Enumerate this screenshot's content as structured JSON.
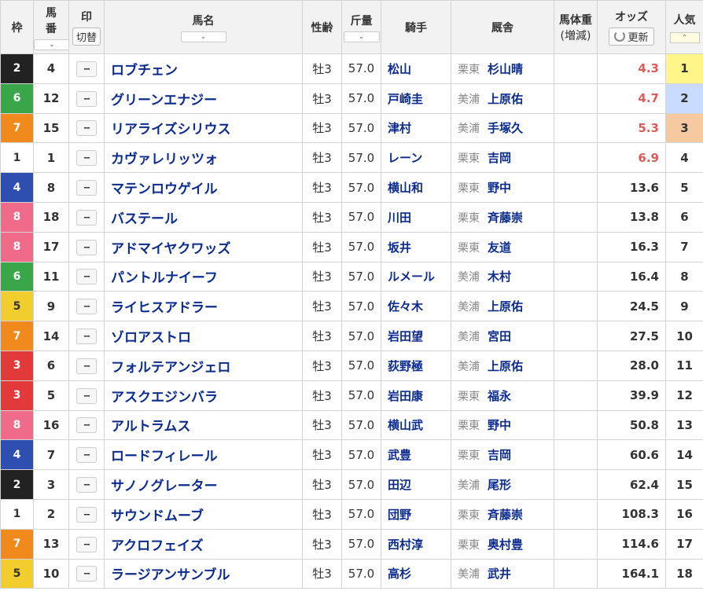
{
  "header": {
    "waku": "枠",
    "umaban_1": "馬",
    "umaban_2": "番",
    "mark": "印",
    "mark_toggle": "切替",
    "name": "馬名",
    "sexage": "性齢",
    "weight": "斤量",
    "jockey": "騎手",
    "stable": "厩舎",
    "bodyweight_1": "馬体重",
    "bodyweight_2": "(増減)",
    "odds": "オッズ",
    "refresh": "更新",
    "popularity": "人気",
    "sort_glyph": "⌄",
    "sort_up_glyph": "⌃"
  },
  "waku_colors": {
    "1": {
      "bg": "#ffffff",
      "fg": "#333333"
    },
    "2": {
      "bg": "#222222",
      "fg": "#ffffff"
    },
    "3": {
      "bg": "#e23a3a",
      "fg": "#ffffff"
    },
    "4": {
      "bg": "#2f4fb0",
      "fg": "#ffffff"
    },
    "5": {
      "bg": "#f2cd2e",
      "fg": "#333333"
    },
    "6": {
      "bg": "#3aa64a",
      "fg": "#ffffff"
    },
    "7": {
      "bg": "#f08a1c",
      "fg": "#ffffff"
    },
    "8": {
      "bg": "#f06a8a",
      "fg": "#ffffff"
    }
  },
  "mark_placeholder": "--",
  "rows": [
    {
      "waku": "2",
      "umaban": "4",
      "name": "ロブチェン",
      "sexage": "牡3",
      "weight": "57.0",
      "jockey": "松山",
      "region": "栗東",
      "trainer": "杉山晴",
      "odds": "4.3",
      "pop": "1"
    },
    {
      "waku": "6",
      "umaban": "12",
      "name": "グリーンエナジー",
      "sexage": "牡3",
      "weight": "57.0",
      "jockey": "戸崎圭",
      "region": "美浦",
      "trainer": "上原佑",
      "odds": "4.7",
      "pop": "2"
    },
    {
      "waku": "7",
      "umaban": "15",
      "name": "リアライズシリウス",
      "sexage": "牡3",
      "weight": "57.0",
      "jockey": "津村",
      "region": "美浦",
      "trainer": "手塚久",
      "odds": "5.3",
      "pop": "3"
    },
    {
      "waku": "1",
      "umaban": "1",
      "name": "カヴァレリッツォ",
      "sexage": "牡3",
      "weight": "57.0",
      "jockey": "レーン",
      "region": "栗東",
      "trainer": "吉岡",
      "odds": "6.9",
      "pop": "4"
    },
    {
      "waku": "4",
      "umaban": "8",
      "name": "マテンロウゲイル",
      "sexage": "牡3",
      "weight": "57.0",
      "jockey": "横山和",
      "region": "栗東",
      "trainer": "野中",
      "odds": "13.6",
      "pop": "5"
    },
    {
      "waku": "8",
      "umaban": "18",
      "name": "バステール",
      "sexage": "牡3",
      "weight": "57.0",
      "jockey": "川田",
      "region": "栗東",
      "trainer": "斉藤崇",
      "odds": "13.8",
      "pop": "6"
    },
    {
      "waku": "8",
      "umaban": "17",
      "name": "アドマイヤクワッズ",
      "sexage": "牡3",
      "weight": "57.0",
      "jockey": "坂井",
      "region": "栗東",
      "trainer": "友道",
      "odds": "16.3",
      "pop": "7"
    },
    {
      "waku": "6",
      "umaban": "11",
      "name": "パントルナイーフ",
      "sexage": "牡3",
      "weight": "57.0",
      "jockey": "ルメール",
      "region": "美浦",
      "trainer": "木村",
      "odds": "16.4",
      "pop": "8"
    },
    {
      "waku": "5",
      "umaban": "9",
      "name": "ライヒスアドラー",
      "sexage": "牡3",
      "weight": "57.0",
      "jockey": "佐々木",
      "region": "美浦",
      "trainer": "上原佑",
      "odds": "24.5",
      "pop": "9"
    },
    {
      "waku": "7",
      "umaban": "14",
      "name": "ゾロアストロ",
      "sexage": "牡3",
      "weight": "57.0",
      "jockey": "岩田望",
      "region": "美浦",
      "trainer": "宮田",
      "odds": "27.5",
      "pop": "10"
    },
    {
      "waku": "3",
      "umaban": "6",
      "name": "フォルテアンジェロ",
      "sexage": "牡3",
      "weight": "57.0",
      "jockey": "荻野極",
      "region": "美浦",
      "trainer": "上原佑",
      "odds": "28.0",
      "pop": "11"
    },
    {
      "waku": "3",
      "umaban": "5",
      "name": "アスクエジンバラ",
      "sexage": "牡3",
      "weight": "57.0",
      "jockey": "岩田康",
      "region": "栗東",
      "trainer": "福永",
      "odds": "39.9",
      "pop": "12"
    },
    {
      "waku": "8",
      "umaban": "16",
      "name": "アルトラムス",
      "sexage": "牡3",
      "weight": "57.0",
      "jockey": "横山武",
      "region": "栗東",
      "trainer": "野中",
      "odds": "50.8",
      "pop": "13"
    },
    {
      "waku": "4",
      "umaban": "7",
      "name": "ロードフィレール",
      "sexage": "牡3",
      "weight": "57.0",
      "jockey": "武豊",
      "region": "栗東",
      "trainer": "吉岡",
      "odds": "60.6",
      "pop": "14"
    },
    {
      "waku": "2",
      "umaban": "3",
      "name": "サノノグレーター",
      "sexage": "牡3",
      "weight": "57.0",
      "jockey": "田辺",
      "region": "美浦",
      "trainer": "尾形",
      "odds": "62.4",
      "pop": "15"
    },
    {
      "waku": "1",
      "umaban": "2",
      "name": "サウンドムーブ",
      "sexage": "牡3",
      "weight": "57.0",
      "jockey": "団野",
      "region": "栗東",
      "trainer": "斉藤崇",
      "odds": "108.3",
      "pop": "16"
    },
    {
      "waku": "7",
      "umaban": "13",
      "name": "アクロフェイズ",
      "sexage": "牡3",
      "weight": "57.0",
      "jockey": "西村淳",
      "region": "栗東",
      "trainer": "奥村豊",
      "odds": "114.6",
      "pop": "17"
    },
    {
      "waku": "5",
      "umaban": "10",
      "name": "ラージアンサンブル",
      "sexage": "牡3",
      "weight": "57.0",
      "jockey": "高杉",
      "region": "美浦",
      "trainer": "武井",
      "odds": "164.1",
      "pop": "18"
    }
  ]
}
